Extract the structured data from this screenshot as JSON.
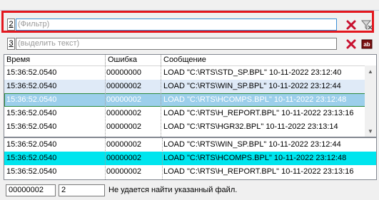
{
  "filter_row": {
    "number": "2",
    "placeholder": "(Фильтр)",
    "clear_icon": "red-x-icon",
    "filter_icon": "funnel-clear-icon"
  },
  "highlight_row": {
    "number": "3",
    "placeholder": "(выделить текст)",
    "clear_icon": "red-x-icon",
    "highlight_icon": "highlight-text-icon"
  },
  "table": {
    "columns": [
      "Время",
      "Ошибка",
      "Сообщение"
    ],
    "rows": [
      {
        "time": "15:36:52.0540",
        "error": "00000000",
        "message": "LOAD \"C:\\RTS\\STD_SP.BPL\" 10-11-2022 23:12:40",
        "state": "normal"
      },
      {
        "time": "15:36:52.0540",
        "error": "00000002",
        "message": "LOAD \"C:\\RTS\\WIN_SP.BPL\" 10-11-2022 23:12:44",
        "state": "alt"
      },
      {
        "time": "15:36:52.0540",
        "error": "00000002",
        "message": "LOAD \"C:\\RTS\\HCOMPS.BPL\" 10-11-2022 23:12:48",
        "state": "selected"
      },
      {
        "time": "15:36:52.0540",
        "error": "00000002",
        "message": "LOAD \"C:\\RTS\\H_REPORT.BPL\" 10-11-2022 23:13:16",
        "state": "normal"
      },
      {
        "time": "15:36:52.0540",
        "error": "00000002",
        "message": "LOAD \"C:\\RTS\\HGR32.BPL\" 10-11-2022 23:13:14",
        "state": "normal"
      }
    ]
  },
  "lower_table": {
    "rows": [
      {
        "time": "15:36:52.0540",
        "error": "00000002",
        "message": "LOAD \"C:\\RTS\\WIN_SP.BPL\" 10-11-2022 23:12:44",
        "state": "normal"
      },
      {
        "time": "15:36:52.0540",
        "error": "00000002",
        "message": "LOAD \"C:\\RTS\\HCOMPS.BPL\" 10-11-2022 23:12:48",
        "state": "cyan"
      },
      {
        "time": "15:36:52.0540",
        "error": "00000002",
        "message": "LOAD \"C:\\RTS\\H_REPORT.BPL\" 10-11-2022 23:13:16",
        "state": "normal"
      }
    ]
  },
  "status_bar": {
    "error_code": "00000002",
    "error_num": "2",
    "message": "Не удается найти указанный файл."
  },
  "colors": {
    "highlight_border": "#e3171e",
    "selected_row": "#9ccfeb",
    "alt_row": "#dfeaf7",
    "cyan_row": "#00e5ee"
  }
}
